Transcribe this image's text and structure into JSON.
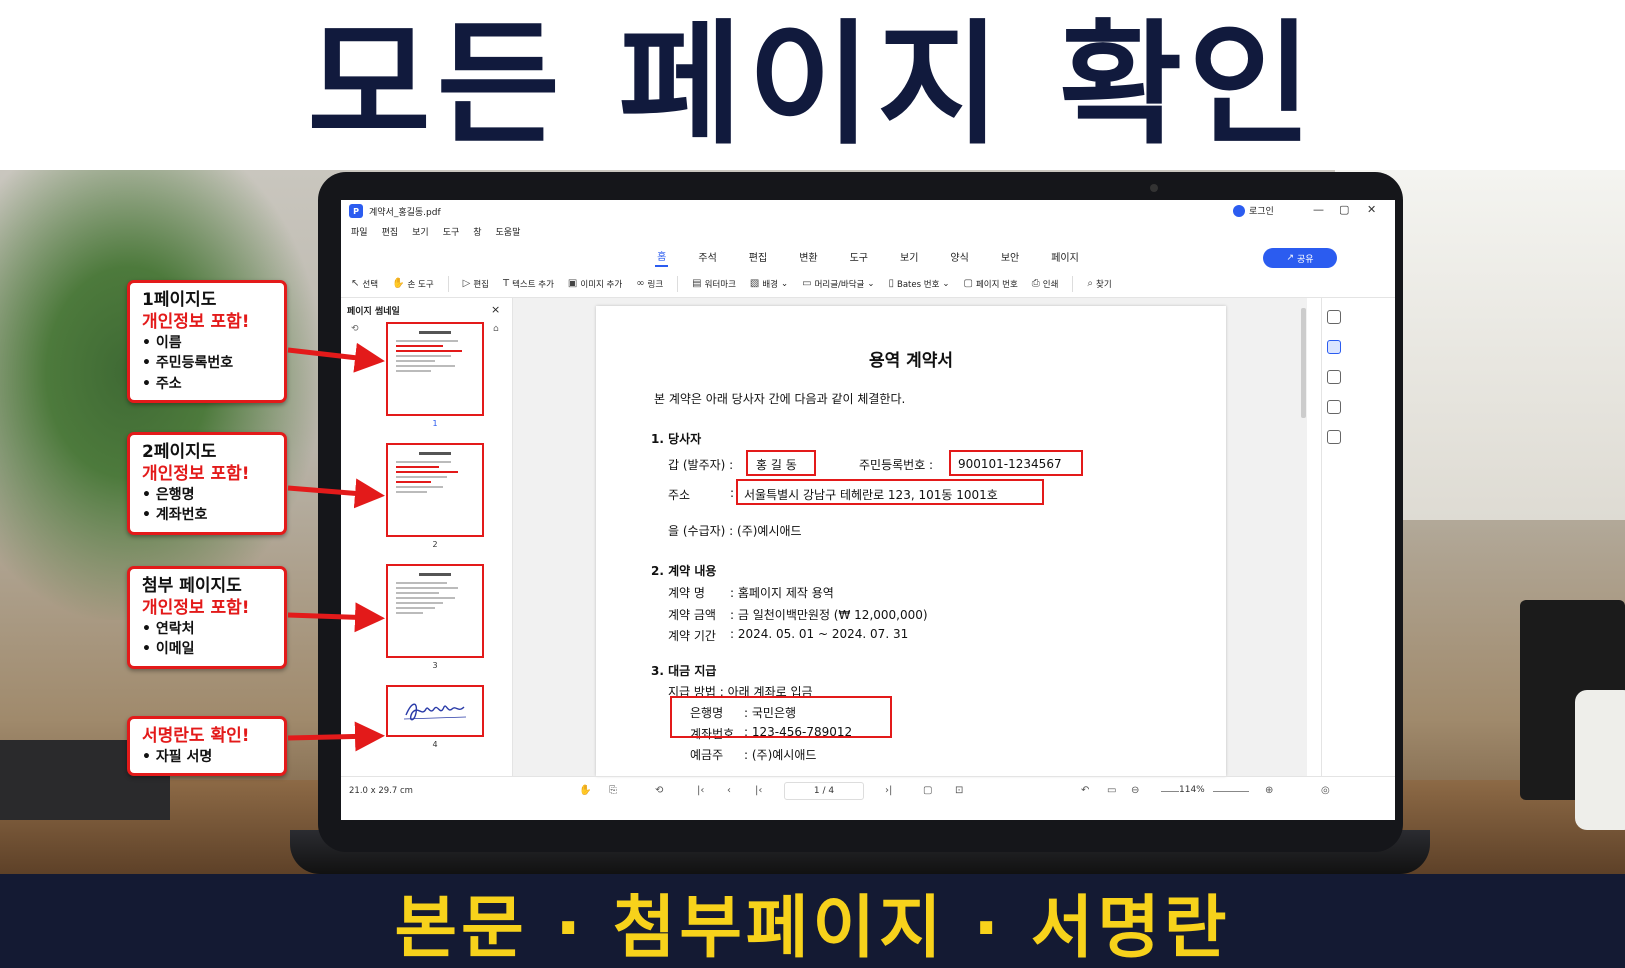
{
  "header": {
    "title": "모든 페이지 확인"
  },
  "footer": {
    "text": "본문 · 첨부페이지 · 서명란"
  },
  "app": {
    "app_icon": "P",
    "doc_name": "계약서_홍길동.pdf",
    "login": "로그인",
    "menu": [
      "파일",
      "편집",
      "보기",
      "도구",
      "창",
      "도움말"
    ],
    "ribbon_tabs": [
      "홈",
      "주석",
      "편집",
      "변환",
      "도구",
      "보기",
      "양식",
      "보안",
      "페이지"
    ],
    "active_tab": "홈",
    "share": "공유",
    "tools": [
      "선택",
      "손 도구",
      "편집",
      "텍스트 추가",
      "이미지 추가",
      "링크",
      "워터마크",
      "배경",
      "머리글/바닥글",
      "Bates 번호",
      "페이지 번호",
      "인쇄",
      "찾기"
    ],
    "accent": "#2b5cf0"
  },
  "sidebar": {
    "title": "페이지 썸네일",
    "pages": [
      "1",
      "2",
      "3",
      "4"
    ],
    "active_page": "1"
  },
  "document": {
    "title": "용역 계약서",
    "intro": "본 계약은 아래 당사자 간에 다음과 같이 체결한다.",
    "s1": {
      "heading": "1. 당사자",
      "party_a_label": "갑 (발주자) :",
      "party_a_name": "홍 길 동",
      "rrn_label": "주민등록번호 :",
      "rrn_value": "900101-1234567",
      "addr_label": "주소",
      "addr_colon": ":",
      "addr_value": "서울특별시 강남구 테헤란로 123, 101동 1001호",
      "party_b": "을 (수급자) :  (주)예시애드"
    },
    "s2": {
      "heading": "2. 계약 내용",
      "name_label": "계약 명",
      "name_value": ":  홈페이지 제작 용역",
      "amount_label": "계약 금액",
      "amount_value": ":  금  일천이백만원정 (₩ 12,000,000)",
      "period_label": "계약 기간",
      "period_value": ":  2024. 05. 01 ~ 2024. 07. 31"
    },
    "s3": {
      "heading": "3. 대금 지급",
      "method": "지급 방법 : 아래 계좌로 입금",
      "bank_label": "은행명",
      "bank_value": ":  국민은행",
      "acct_label": "계좌번호",
      "acct_value": ":  123-456-789012",
      "holder_label": "예금주",
      "holder_value": ":  (주)예시애드"
    }
  },
  "statusbar": {
    "page_size": "21.0 x 29.7 cm",
    "page_indicator": "1  / 4",
    "zoom": "114%"
  },
  "callouts": [
    {
      "line1": "1페이지도",
      "line2": "개인정보 포함!",
      "items": [
        "• 이름",
        "• 주민등록번호",
        "• 주소"
      ]
    },
    {
      "line1": "2페이지도",
      "line2": "개인정보 포함!",
      "items": [
        "• 은행명",
        "• 계좌번호"
      ]
    },
    {
      "line1": "첨부 페이지도",
      "line2": "개인정보 포함!",
      "items": [
        "• 연락처",
        "• 이메일"
      ]
    },
    {
      "line1": "",
      "line2": "서명란도 확인!",
      "items": [
        "• 자필 서명"
      ]
    }
  ],
  "colors": {
    "highlight": "#e31a1a",
    "footer_bg": "#141a33",
    "footer_text": "#f7d21b",
    "title": "#111a3d"
  }
}
